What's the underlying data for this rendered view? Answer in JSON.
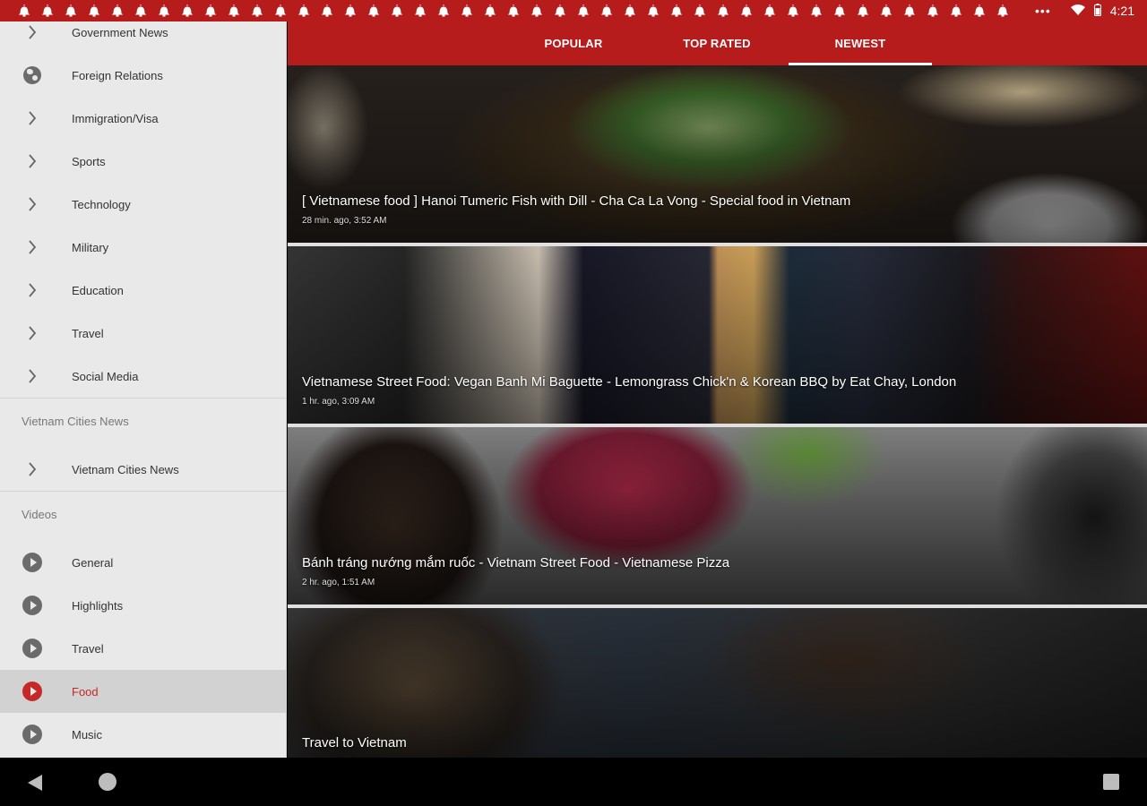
{
  "status_bar": {
    "time": "4:21",
    "notification_icon": "bell-icon",
    "notification_count": 43,
    "more_icon": "more-dots-icon",
    "wifi_icon": "wifi-icon",
    "battery_icon": "battery-icon"
  },
  "drawer": {
    "top_items": [
      {
        "label": "Government News",
        "icon": "chevron-right-icon"
      },
      {
        "label": "Foreign Relations",
        "icon": "globe-icon"
      },
      {
        "label": "Immigration/Visa",
        "icon": "chevron-right-icon"
      },
      {
        "label": "Sports",
        "icon": "chevron-right-icon"
      },
      {
        "label": "Technology",
        "icon": "chevron-right-icon"
      },
      {
        "label": "Military",
        "icon": "chevron-right-icon"
      },
      {
        "label": "Education",
        "icon": "chevron-right-icon"
      },
      {
        "label": "Travel",
        "icon": "chevron-right-icon"
      },
      {
        "label": "Social Media",
        "icon": "chevron-right-icon"
      }
    ],
    "cities_section": {
      "header": "Vietnam Cities News",
      "items": [
        {
          "label": "Vietnam Cities News",
          "icon": "chevron-right-icon"
        }
      ]
    },
    "videos_section": {
      "header": "Videos",
      "items": [
        {
          "label": "General",
          "icon": "play-circle-icon"
        },
        {
          "label": "Highlights",
          "icon": "play-circle-icon"
        },
        {
          "label": "Travel",
          "icon": "play-circle-icon"
        },
        {
          "label": "Food",
          "icon": "play-circle-icon",
          "active": true
        },
        {
          "label": "Music",
          "icon": "play-circle-icon"
        }
      ]
    }
  },
  "tabs": [
    {
      "label": "POPULAR"
    },
    {
      "label": "TOP RATED"
    },
    {
      "label": "NEWEST",
      "selected": true
    }
  ],
  "videos": [
    {
      "title": "[ Vietnamese food ] Hanoi Tumeric Fish with Dill - Cha Ca La Vong - Special food in Vietnam",
      "meta": "28 min. ago, 3:52 AM"
    },
    {
      "title": "Vietnamese Street Food: Vegan Banh Mi Baguette - Lemongrass Chick'n & Korean BBQ by Eat Chay, London",
      "meta": "1 hr. ago, 3:09 AM"
    },
    {
      "title": "Bánh tráng nướng mắm ruốc - Vietnam Street Food - Vietnamese Pizza",
      "meta": "2 hr. ago, 1:51 AM"
    },
    {
      "title": "Travel to Vietnam",
      "meta": ""
    }
  ],
  "nav_bar": {
    "back_icon": "back-triangle-icon",
    "home_icon": "home-circle-icon",
    "recents_icon": "recents-square-icon"
  },
  "colors": {
    "brand_red": "#b71c1c",
    "active_red": "#c62828",
    "drawer_bg": "#e9e9e9"
  }
}
